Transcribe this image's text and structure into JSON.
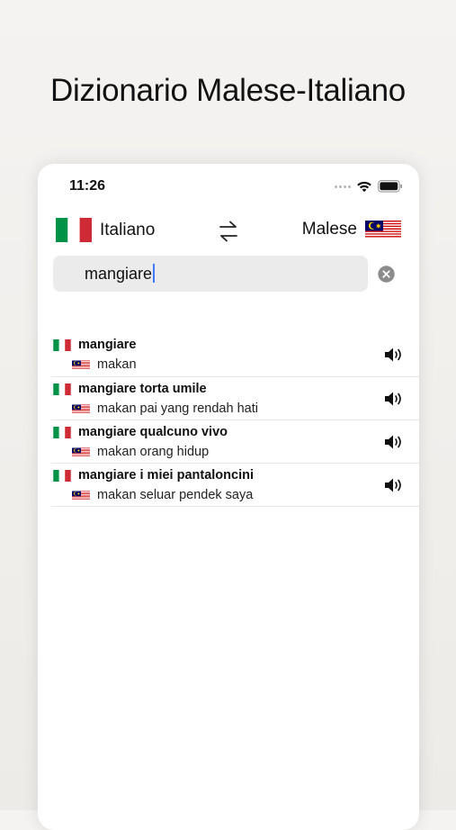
{
  "headline": "Dizionario Malese-Italiano",
  "status_bar": {
    "time": "11:26"
  },
  "languages": {
    "source_label": "Italiano",
    "target_label": "Malese",
    "source_flag": "italy-flag",
    "target_flag": "malaysia-flag",
    "swap_icon": "swap-arrows-icon"
  },
  "search": {
    "value": "mangiare",
    "clear_icon": "clear-circle-icon"
  },
  "results": [
    {
      "source": "mangiare",
      "translation": "makan"
    },
    {
      "source": "mangiare torta umile",
      "translation": "makan pai yang rendah hati"
    },
    {
      "source": "mangiare qualcuno vivo",
      "translation": "makan orang hidup"
    },
    {
      "source": "mangiare i miei pantaloncini",
      "translation": "makan seluar pendek saya"
    }
  ],
  "colors": {
    "italy_green": "#009246",
    "italy_red": "#ce2b37",
    "malaysia_red": "#cc0001",
    "malaysia_blue": "#010066",
    "malaysia_yellow": "#ffcc00",
    "caret": "#3d7bf6"
  }
}
